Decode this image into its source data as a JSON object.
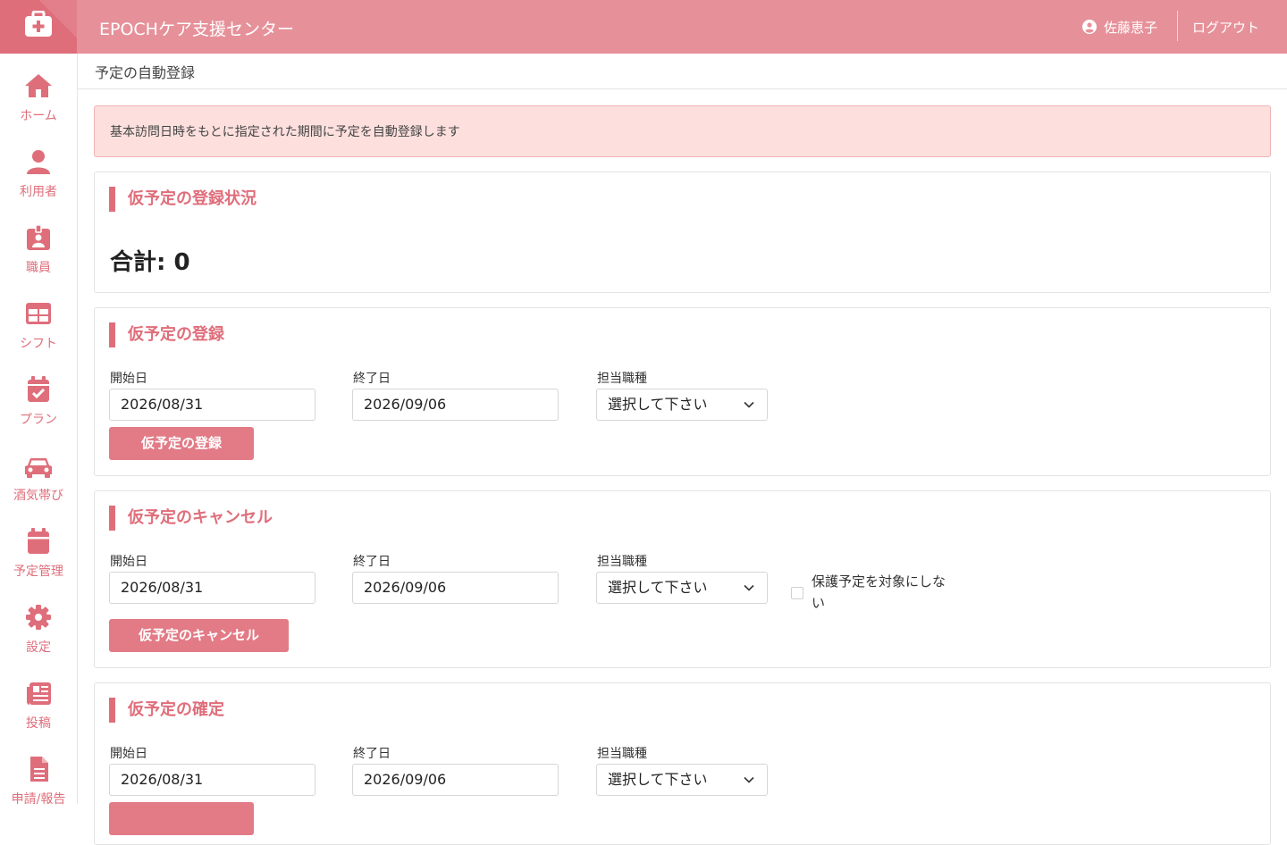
{
  "header": {
    "title": "EPOCHケア支援センター",
    "user_name": "佐藤恵子",
    "logout_label": "ログアウト"
  },
  "sidebar": {
    "items": [
      {
        "label": "ホーム",
        "icon": "home-icon"
      },
      {
        "label": "利用者",
        "icon": "user-icon"
      },
      {
        "label": "職員",
        "icon": "id-badge-icon"
      },
      {
        "label": "シフト",
        "icon": "table-icon"
      },
      {
        "label": "プラン",
        "icon": "calendar-check-icon"
      },
      {
        "label": "酒気帯び",
        "icon": "car-icon"
      },
      {
        "label": "予定管理",
        "icon": "calendar-icon"
      },
      {
        "label": "設定",
        "icon": "gear-icon"
      },
      {
        "label": "投稿",
        "icon": "newspaper-icon"
      },
      {
        "label": "申請/報告",
        "icon": "document-icon"
      }
    ]
  },
  "breadcrumb": "予定の自動登録",
  "alert": "基本訪問日時をもとに指定された期間に予定を自動登録します",
  "status": {
    "title": "仮予定の登録状況",
    "total_text": "合計: 0"
  },
  "register": {
    "title": "仮予定の登録",
    "start_label": "開始日",
    "start_value": "2026/08/31",
    "end_label": "終了日",
    "end_value": "2026/09/06",
    "role_label": "担当職種",
    "role_value": "選択して下さい",
    "button": "仮予定の登録"
  },
  "cancel": {
    "title": "仮予定のキャンセル",
    "start_label": "開始日",
    "start_value": "2026/08/31",
    "end_label": "終了日",
    "end_value": "2026/09/06",
    "role_label": "担当職種",
    "role_value": "選択して下さい",
    "checkbox_label": "保護予定を対象にしない",
    "button": "仮予定のキャンセル"
  },
  "confirm": {
    "title": "仮予定の確定",
    "start_label": "開始日",
    "start_value": "2026/08/31",
    "end_label": "終了日",
    "end_value": "2026/09/06",
    "role_label": "担当職種",
    "role_value": "選択して下さい"
  },
  "colors": {
    "header": "#e6919a",
    "accent": "#df6e7b",
    "button": "#e27b86",
    "alert_bg": "#fde0de"
  }
}
